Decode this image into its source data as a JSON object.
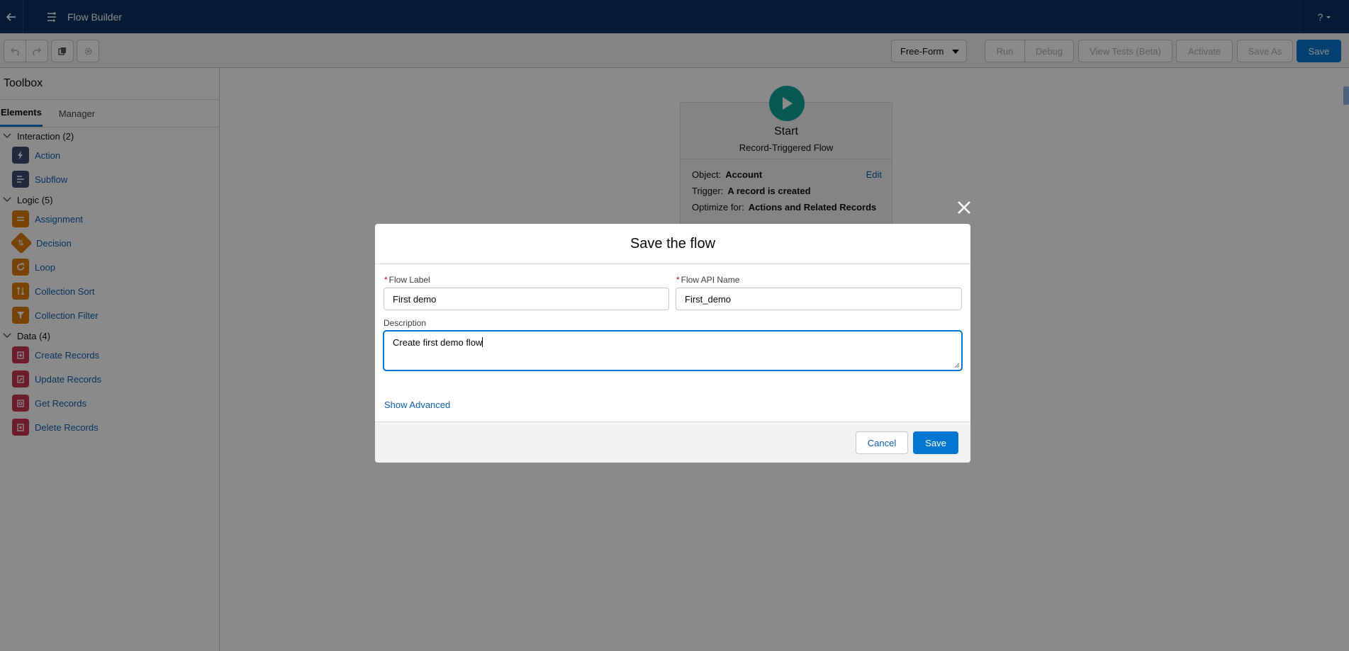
{
  "app": {
    "title": "Flow Builder",
    "help_label": "?"
  },
  "toolbar": {
    "layout_mode": "Free-Form",
    "run": "Run",
    "debug": "Debug",
    "view_tests": "View Tests (Beta)",
    "activate": "Activate",
    "save_as": "Save As",
    "save": "Save"
  },
  "sidebar": {
    "title": "Toolbox",
    "tabs": [
      {
        "label": "Elements",
        "active": true
      },
      {
        "label": "Manager",
        "active": false
      }
    ],
    "sections": [
      {
        "label": "Interaction (2)",
        "items": [
          {
            "label": "Action",
            "icon": "lightning-icon"
          },
          {
            "label": "Subflow",
            "icon": "flow-icon"
          }
        ]
      },
      {
        "label": "Logic (5)",
        "items": [
          {
            "label": "Assignment",
            "icon": "equals-icon"
          },
          {
            "label": "Decision",
            "icon": "decision-icon"
          },
          {
            "label": "Loop",
            "icon": "loop-icon"
          },
          {
            "label": "Collection Sort",
            "icon": "sort-icon"
          },
          {
            "label": "Collection Filter",
            "icon": "filter-icon"
          }
        ]
      },
      {
        "label": "Data (4)",
        "items": [
          {
            "label": "Create Records",
            "icon": "record-create-icon"
          },
          {
            "label": "Update Records",
            "icon": "record-update-icon"
          },
          {
            "label": "Get Records",
            "icon": "record-lookup-icon"
          },
          {
            "label": "Delete Records",
            "icon": "record-delete-icon"
          }
        ]
      }
    ]
  },
  "canvas": {
    "start": {
      "title": "Start",
      "subtitle": "Record-Triggered Flow",
      "object_label": "Object:",
      "object_value": "Account",
      "edit": "Edit",
      "trigger_label": "Trigger:",
      "trigger_value": "A record is created",
      "optimize_label": "Optimize for:",
      "optimize_value": "Actions and Related Records"
    }
  },
  "modal": {
    "title": "Save the flow",
    "flow_label": {
      "label": "Flow Label",
      "required": "*",
      "value": "First demo"
    },
    "flow_api_name": {
      "label": "Flow API Name",
      "required": "*",
      "value": "First_demo"
    },
    "description": {
      "label": "Description",
      "value": "Create first demo flow"
    },
    "show_advanced": "Show Advanced",
    "cancel": "Cancel",
    "save": "Save"
  },
  "colors": {
    "brand": "#0176d3",
    "header": "#032d60",
    "start_node": "#06a59a"
  }
}
